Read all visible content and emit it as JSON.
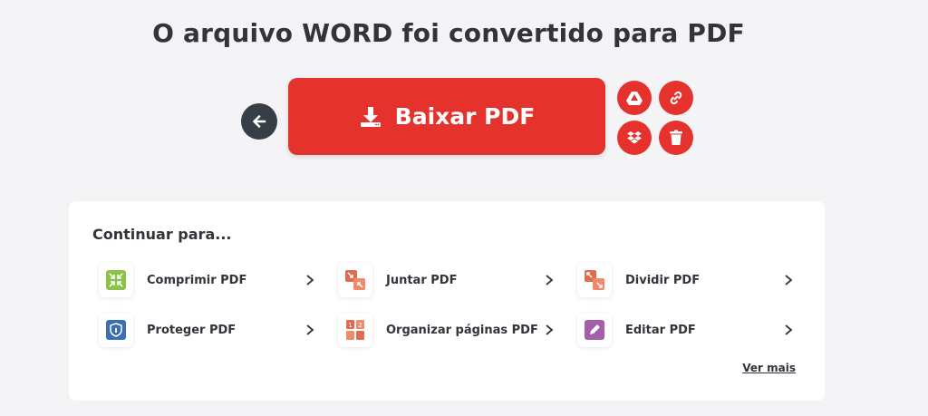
{
  "header": {
    "title": "O arquivo WORD foi convertido para PDF"
  },
  "actions": {
    "download_label": "Baixar PDF",
    "back_icon": "arrow-left-icon",
    "extra": [
      {
        "name": "google-drive",
        "icon": "google-drive-icon"
      },
      {
        "name": "share-link",
        "icon": "link-icon"
      },
      {
        "name": "dropbox",
        "icon": "dropbox-icon"
      },
      {
        "name": "delete",
        "icon": "trash-icon"
      }
    ]
  },
  "continue_section": {
    "title": "Continuar para...",
    "tools": [
      {
        "label": "Comprimir PDF",
        "icon": "compress-icon",
        "color": "#8bc34a"
      },
      {
        "label": "Juntar PDF",
        "icon": "merge-icon",
        "color": "#e26a4f"
      },
      {
        "label": "Dividir PDF",
        "icon": "split-icon",
        "color": "#e26a4f"
      },
      {
        "label": "Proteger PDF",
        "icon": "shield-icon",
        "color": "#3c6eb4"
      },
      {
        "label": "Organizar páginas PDF",
        "icon": "organize-icon",
        "color": "#e26a4f"
      },
      {
        "label": "Editar PDF",
        "icon": "edit-pen-icon",
        "color": "#a55ea8"
      }
    ],
    "more_link": "Ver mais"
  },
  "colors": {
    "brand_red": "#e5322d",
    "dark": "#383e45",
    "background": "#f4f4f6"
  }
}
